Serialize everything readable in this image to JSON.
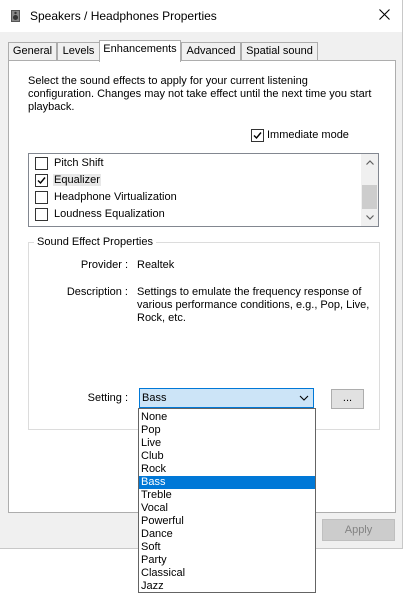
{
  "window": {
    "title": "Speakers / Headphones Properties",
    "accent_color": "#0078d7"
  },
  "tabs": [
    {
      "label": "General"
    },
    {
      "label": "Levels"
    },
    {
      "label": "Enhancements",
      "active": true
    },
    {
      "label": "Advanced"
    },
    {
      "label": "Spatial sound"
    }
  ],
  "enhancements": {
    "description": "Select the sound effects to apply for your current listening\nconfiguration. Changes may not take effect until the next time you start\nplayback.",
    "immediate_mode": {
      "label": "Immediate mode",
      "checked": true
    },
    "effects": [
      {
        "label": "Pitch Shift",
        "checked": false
      },
      {
        "label": "Equalizer",
        "checked": true,
        "selected": true
      },
      {
        "label": "Headphone Virtualization",
        "checked": false
      },
      {
        "label": "Loudness Equalization",
        "checked": false
      }
    ]
  },
  "sound_effect_properties": {
    "group_title": "Sound Effect Properties",
    "provider_label": "Provider :",
    "provider_value": "Realtek",
    "description_label": "Description :",
    "description_value": "Settings to emulate the frequency response of various performance conditions,  e.g., Pop, Live, Rock, etc.",
    "setting_label": "Setting :",
    "setting_value": "Bass",
    "more_button_label": "...",
    "setting_options": [
      "None",
      "Pop",
      "Live",
      "Club",
      "Rock",
      "Bass",
      "Treble",
      "Vocal",
      "Powerful",
      "Dance",
      "Soft",
      "Party",
      "Classical",
      "Jazz"
    ],
    "selected_option": "Bass"
  },
  "footer": {
    "apply_label": "Apply",
    "apply_enabled": false
  }
}
